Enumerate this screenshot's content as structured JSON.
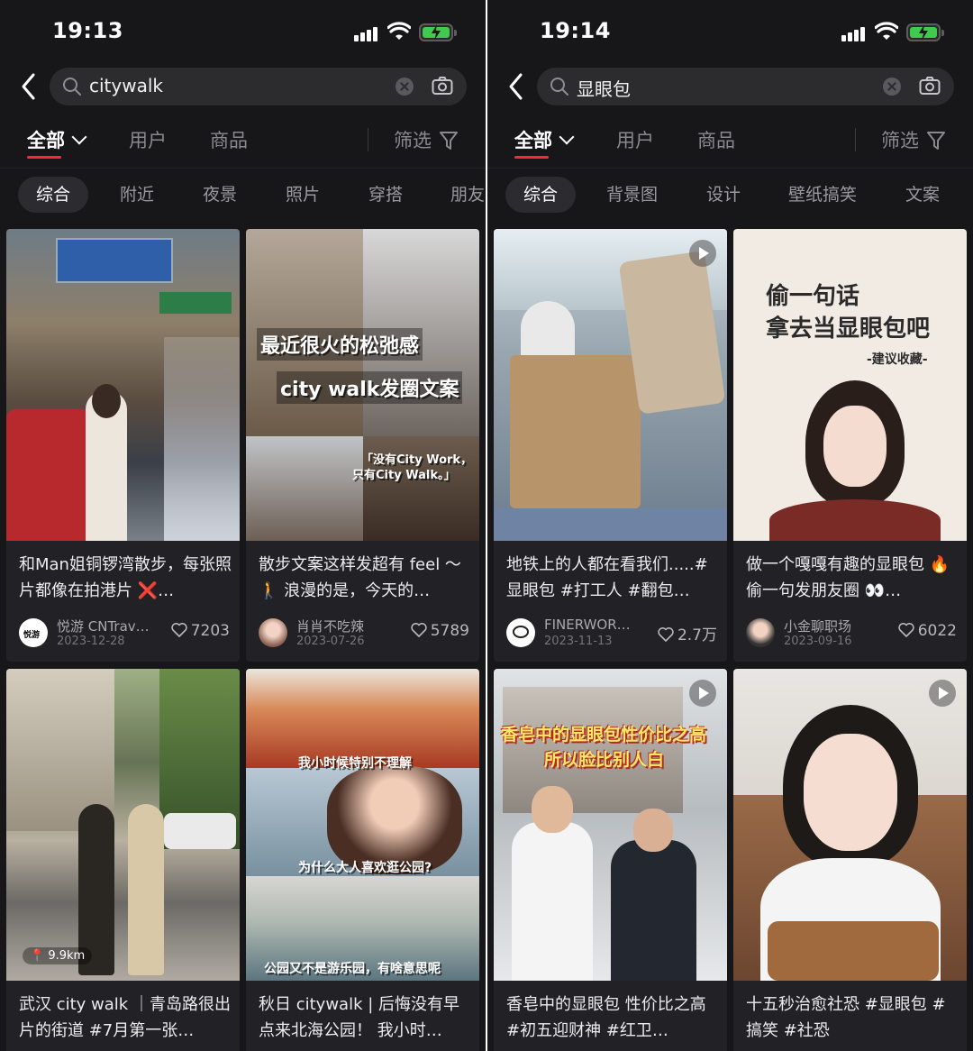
{
  "left": {
    "status": {
      "time": "19:13"
    },
    "search": {
      "query": "citywalk"
    },
    "tabs": {
      "all": "全部",
      "users": "用户",
      "goods": "商品",
      "filter": "筛选"
    },
    "chips": [
      "综合",
      "附近",
      "夜景",
      "照片",
      "穿搭",
      "朋友"
    ],
    "cards": [
      {
        "title": "和Man姐铜锣湾散步，每张照片都像在拍港片 ❌…",
        "user": "悦游 CNTrav…",
        "date": "2023-12-28",
        "likes": "7203"
      },
      {
        "title": "散步文案这样发超有 feel ～ 🚶 浪漫的是，今天的…",
        "user": "肖肖不吃辣",
        "date": "2023-07-26",
        "likes": "5789",
        "overlay": [
          "最近很火的松弛感",
          "city walk发圈文案",
          "「没有City Work，",
          "只有City Walk。」"
        ]
      },
      {
        "title": "武汉 city walk ｜青岛路很出片的街道 #7月第一张…",
        "distance": "9.9km"
      },
      {
        "title": "秋日 citywalk | 后悔没有早点来北海公园！ 我小时…",
        "overlay": [
          "我小时候特别不理解",
          "为什么大人喜欢逛公园?",
          "公园又不是游乐园，有啥意思呢"
        ]
      }
    ]
  },
  "right": {
    "status": {
      "time": "19:14"
    },
    "search": {
      "query": "显眼包"
    },
    "tabs": {
      "all": "全部",
      "users": "用户",
      "goods": "商品",
      "filter": "筛选"
    },
    "chips": [
      "综合",
      "背景图",
      "设计",
      "壁纸搞笑",
      "文案"
    ],
    "cards": [
      {
        "title": "地铁上的人都在看我们.....#显眼包 #打工人 #翻包…",
        "user": "FINERWOR…",
        "date": "2023-11-13",
        "likes": "2.7万"
      },
      {
        "title": "做一个嘎嘎有趣的显眼包 🔥 偷一句发朋友圈 👀…",
        "user": "小金聊职场",
        "date": "2023-09-16",
        "likes": "6022",
        "overlay": [
          "偷一句话",
          "拿去当显眼包吧",
          "-建议收藏-"
        ]
      },
      {
        "title": "香皂中的显眼包 性价比之高 #初五迎财神 #红卫…",
        "overlay": [
          "香皂中的显眼包性价比之高",
          "所以脸比别人白"
        ]
      },
      {
        "title": "十五秒治愈社恐 #显眼包 #搞笑 #社恐"
      }
    ]
  },
  "colors": {
    "accent": "#ff2442",
    "background": "#17171a",
    "card": "#222226"
  }
}
